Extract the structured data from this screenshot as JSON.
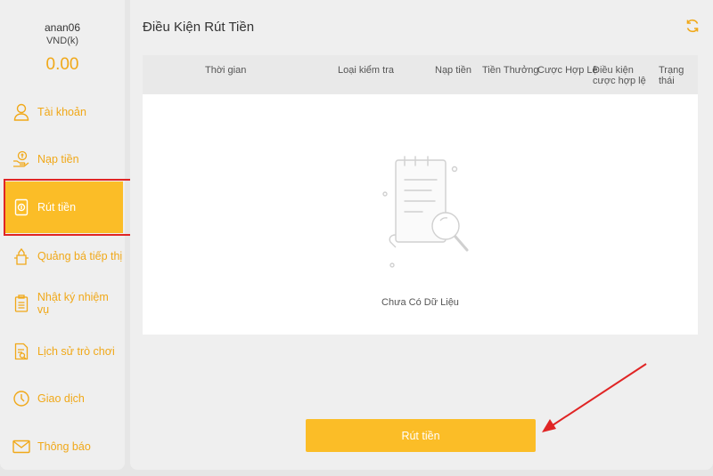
{
  "user": {
    "name": "anan06",
    "currency": "VND(k)",
    "balance": "0.00"
  },
  "sidebar": {
    "items": [
      {
        "label": "Tài khoản",
        "icon": "user-icon"
      },
      {
        "label": "Nạp tiền",
        "icon": "deposit-icon"
      },
      {
        "label": "Rút tiền",
        "icon": "withdraw-icon",
        "active": true
      },
      {
        "label": "Quảng bá tiếp thị",
        "icon": "promotion-icon"
      },
      {
        "label": "Nhật ký nhiệm vụ",
        "icon": "clipboard-icon"
      },
      {
        "label": "Lịch sử trò chơi",
        "icon": "history-icon"
      },
      {
        "label": "Giao dịch",
        "icon": "clock-icon"
      },
      {
        "label": "Thông báo",
        "icon": "mail-icon"
      }
    ]
  },
  "main": {
    "title": "Điều Kiện Rút Tiền",
    "table": {
      "columns": [
        "Thời gian",
        "Loại kiểm tra",
        "Nạp tiền",
        "Tiền Thưởng",
        "Cược Hợp Lệ",
        "Điều kiện cược hợp lệ",
        "Trạng thái"
      ],
      "rows": [],
      "empty_text": "Chưa Có Dữ Liệu"
    },
    "withdraw_button": "Rút tiền"
  },
  "colors": {
    "accent": "#fbbd27",
    "accent_text": "#f0a818",
    "annotation": "#e02525"
  }
}
